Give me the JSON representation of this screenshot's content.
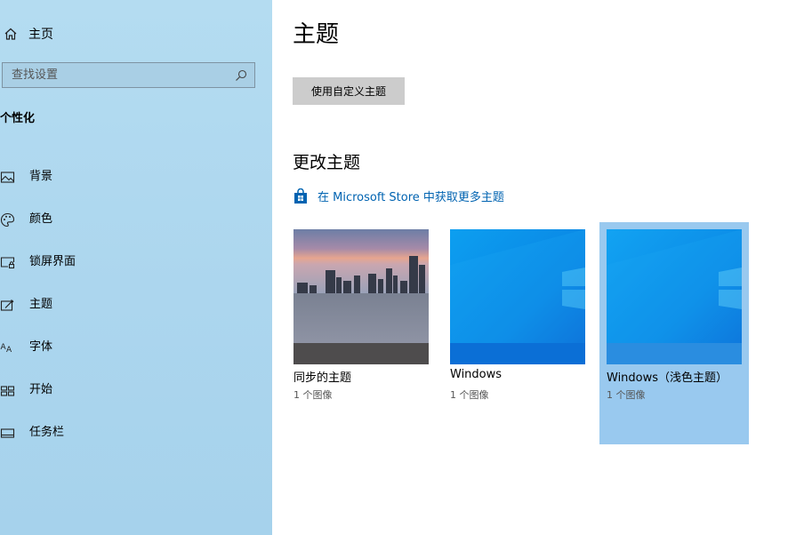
{
  "sidebar": {
    "home_label": "主页",
    "search_placeholder": "查找设置",
    "section_title": "个性化",
    "items": [
      {
        "label": "背景",
        "icon": "picture-icon"
      },
      {
        "label": "颜色",
        "icon": "palette-icon"
      },
      {
        "label": "锁屏界面",
        "icon": "lock-screen-icon"
      },
      {
        "label": "主题",
        "icon": "theme-icon"
      },
      {
        "label": "字体",
        "icon": "font-icon"
      },
      {
        "label": "开始",
        "icon": "start-icon"
      },
      {
        "label": "任务栏",
        "icon": "taskbar-icon"
      }
    ]
  },
  "main": {
    "title": "主题",
    "custom_theme_button": "使用自定义主题",
    "change_theme_heading": "更改主题",
    "store_link": "在 Microsoft Store 中获取更多主题",
    "themes": [
      {
        "name": "同步的主题",
        "count": "1 个图像",
        "selected": false
      },
      {
        "name": "Windows",
        "count": "1 个图像",
        "selected": false
      },
      {
        "name": "Windows（浅色主题）",
        "count": "1 个图像",
        "selected": true
      }
    ]
  },
  "colors": {
    "accent": "#0063b1",
    "selected_tile": "#99c9ef",
    "sidebar_bg": "#b0d9ef"
  }
}
